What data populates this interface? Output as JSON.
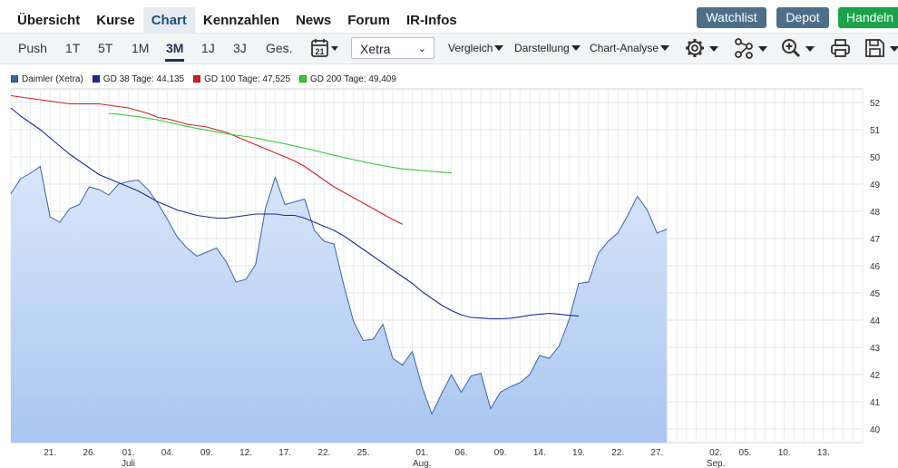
{
  "nav": {
    "tabs": [
      "Übersicht",
      "Kurse",
      "Chart",
      "Kennzahlen",
      "News",
      "Forum",
      "IR-Infos"
    ],
    "active_tab": "Chart",
    "buttons": {
      "watchlist": "Watchlist",
      "depot": "Depot",
      "handeln": "Handeln"
    }
  },
  "toolbar": {
    "periods": [
      "Push",
      "1T",
      "5T",
      "1M",
      "3M",
      "1J",
      "3J",
      "Ges."
    ],
    "active_period": "3M",
    "calendar_day": "21",
    "exchange": "Xetra",
    "menus": {
      "vergleich": "Vergleich",
      "darstellung": "Darstellung",
      "analyse": "Chart-Analyse"
    },
    "icons": [
      "settings-icon",
      "indicators-icon",
      "zoom-icon",
      "print-icon",
      "save-icon"
    ]
  },
  "legend": {
    "items": [
      {
        "label": "Daimler (Xetra)",
        "color": "#3a64a8"
      },
      {
        "label": "GD 38 Tage: 44,135",
        "color": "#1f2a99"
      },
      {
        "label": "GD 100 Tage: 47,525",
        "color": "#d62020"
      },
      {
        "label": "GD 200 Tage: 49,409",
        "color": "#33cc33"
      }
    ]
  },
  "chart_data": {
    "type": "area",
    "ylim": [
      39.5,
      52.5
    ],
    "y_ticks": [
      40,
      41,
      42,
      43,
      44,
      45,
      46,
      47,
      48,
      49,
      50,
      51,
      52
    ],
    "x_tick_labels": [
      "21.",
      "26.",
      "01.",
      "04.",
      "09.",
      "12.",
      "17.",
      "22.",
      "25.",
      "01.",
      "06.",
      "09.",
      "14.",
      "19.",
      "22.",
      "27.",
      "02.",
      "05.",
      "10.",
      "13."
    ],
    "x_tick_index": [
      4,
      8,
      12,
      16,
      20,
      24,
      28,
      32,
      36,
      42,
      46,
      50,
      54,
      58,
      62,
      66,
      72,
      75,
      79,
      83
    ],
    "month_labels": [
      {
        "label": "Juli",
        "index": 12
      },
      {
        "label": "Aug.",
        "index": 42
      },
      {
        "label": "Sep.",
        "index": 72
      }
    ],
    "x_range": [
      0,
      87
    ],
    "grid": true,
    "legend_position": "top-left",
    "series": [
      {
        "name": "Daimler (Xetra)",
        "color": "#3a64a8",
        "x_start": 0,
        "values": [
          48.65,
          49.2,
          49.4,
          49.65,
          47.8,
          47.6,
          48.1,
          48.25,
          48.9,
          48.8,
          48.6,
          49.0,
          49.1,
          49.15,
          48.8,
          48.3,
          47.7,
          47.05,
          46.65,
          46.35,
          46.5,
          46.65,
          46.15,
          45.4,
          45.5,
          46.05,
          48.1,
          49.25,
          48.25,
          48.35,
          48.45,
          47.3,
          46.9,
          46.8,
          45.3,
          43.95,
          43.25,
          43.3,
          43.85,
          42.6,
          42.35,
          42.85,
          41.55,
          40.55,
          41.3,
          42.0,
          41.35,
          41.95,
          42.05,
          40.75,
          41.35,
          41.55,
          41.7,
          42.0,
          42.7,
          42.6,
          43.05,
          44.0,
          45.35,
          45.4,
          46.45,
          46.9,
          47.2,
          47.85,
          48.55,
          48.05,
          47.2,
          47.35
        ]
      },
      {
        "name": "GD 38 Tage: 44,135",
        "color": "#1f2a99",
        "x_start": 0,
        "values": [
          51.8,
          51.5,
          51.25,
          51.0,
          50.7,
          50.4,
          50.1,
          49.85,
          49.6,
          49.35,
          49.2,
          49.05,
          48.9,
          48.75,
          48.55,
          48.35,
          48.2,
          48.05,
          47.95,
          47.85,
          47.8,
          47.75,
          47.75,
          47.8,
          47.85,
          47.9,
          47.9,
          47.9,
          47.85,
          47.85,
          47.75,
          47.6,
          47.45,
          47.3,
          47.1,
          46.85,
          46.6,
          46.35,
          46.1,
          45.85,
          45.6,
          45.35,
          45.05,
          44.8,
          44.55,
          44.35,
          44.2,
          44.1,
          44.08,
          44.05,
          44.05,
          44.07,
          44.12,
          44.18,
          44.22,
          44.25,
          44.22,
          44.18,
          44.15
        ]
      },
      {
        "name": "GD 100 Tage: 47,525",
        "color": "#d62020",
        "x_start": 0,
        "values": [
          52.25,
          52.2,
          52.15,
          52.1,
          52.05,
          52.0,
          51.95,
          51.95,
          51.95,
          51.95,
          51.9,
          51.85,
          51.8,
          51.7,
          51.6,
          51.45,
          51.4,
          51.3,
          51.2,
          51.15,
          51.1,
          51.0,
          50.9,
          50.75,
          50.6,
          50.45,
          50.3,
          50.15,
          50.0,
          49.85,
          49.65,
          49.4,
          49.15,
          48.9,
          48.7,
          48.5,
          48.3,
          48.1,
          47.9,
          47.7,
          47.525
        ]
      },
      {
        "name": "GD 200 Tage: 49,409",
        "color": "#33cc33",
        "x_start": 10,
        "values": [
          51.6,
          51.57,
          51.52,
          51.48,
          51.42,
          51.36,
          51.28,
          51.2,
          51.12,
          51.05,
          50.98,
          50.92,
          50.85,
          50.8,
          50.75,
          50.7,
          50.62,
          50.55,
          50.48,
          50.4,
          50.32,
          50.24,
          50.15,
          50.06,
          49.98,
          49.9,
          49.82,
          49.75,
          49.68,
          49.62,
          49.56,
          49.53,
          49.5,
          49.47,
          49.44,
          49.409
        ]
      }
    ]
  }
}
